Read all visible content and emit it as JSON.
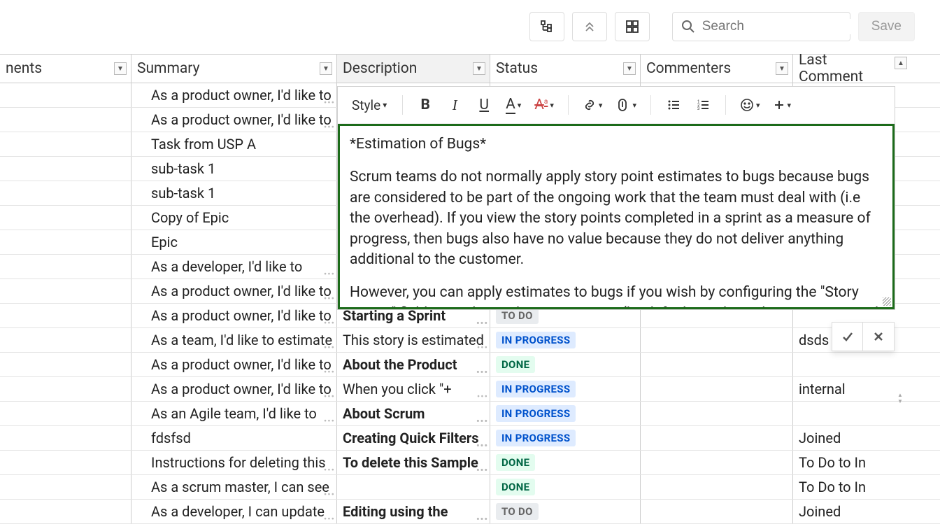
{
  "toolbar": {
    "search_placeholder": "Search",
    "save_label": "Save"
  },
  "columns": {
    "nents": "nents",
    "summary": "Summary",
    "description": "Description",
    "status": "Status",
    "commenters": "Commenters",
    "last_comment": "Last Comment"
  },
  "rows": [
    {
      "summary": "As a product owner, I'd like to",
      "summary_dots": true
    },
    {
      "summary": "As a product owner, I'd like to",
      "summary_dots": true
    },
    {
      "summary": "Task from USP A"
    },
    {
      "summary": "sub-task 1"
    },
    {
      "summary": "sub-task 1"
    },
    {
      "summary": "Copy of Epic"
    },
    {
      "summary": "Epic"
    },
    {
      "summary": "As a developer, I'd like to",
      "summary_dots": true
    },
    {
      "summary": "As a product owner, I'd like to",
      "summary_dots": true
    },
    {
      "summary": "As a product owner, I'd like to",
      "summary_dots": true,
      "description": "Starting a Sprint",
      "desc_bold": true,
      "desc_dots": true,
      "status": "TO DO",
      "status_class": "st-todo"
    },
    {
      "summary": "As a team, I'd like to estimate",
      "summary_dots": true,
      "description": "This story is estimated",
      "desc_dots": true,
      "status": "IN PROGRESS",
      "status_class": "st-inprogress",
      "last": "dsds"
    },
    {
      "summary": "As a product owner, I'd like to",
      "summary_dots": true,
      "description": "About the Product",
      "desc_bold": true,
      "desc_dots": true,
      "status": "DONE",
      "status_class": "st-done"
    },
    {
      "summary": "As a product owner, I'd like to",
      "summary_dots": true,
      "description": "When you click \"+",
      "desc_dots": true,
      "status": "IN PROGRESS",
      "status_class": "st-inprogress",
      "last": "internal"
    },
    {
      "summary": "As an Agile team, I'd like to",
      "summary_dots": true,
      "description": "About Scrum",
      "desc_bold": true,
      "desc_dots": true,
      "status": "IN PROGRESS",
      "status_class": "st-inprogress"
    },
    {
      "summary": "fdsfsd",
      "description": "Creating Quick Filters",
      "desc_bold": true,
      "desc_dots": true,
      "status": "IN PROGRESS",
      "status_class": "st-inprogress",
      "last": "Joined"
    },
    {
      "summary": "Instructions for deleting this",
      "summary_dots": true,
      "description": "To delete this Sample",
      "desc_bold": true,
      "desc_dots": true,
      "status": "DONE",
      "status_class": "st-done",
      "last": "To Do to In"
    },
    {
      "summary": "As a scrum master, I can see",
      "summary_dots": true,
      "status": "DONE",
      "status_class": "st-done",
      "last": "To Do to In"
    },
    {
      "summary": "As a developer, I can update",
      "summary_dots": true,
      "description": "Editing using the",
      "desc_bold": true,
      "desc_dots": true,
      "status": "TO DO",
      "status_class": "st-todo",
      "last": "Joined"
    }
  ],
  "editor": {
    "style_label": "Style",
    "content_p1": "*Estimation of Bugs*",
    "content_p2": "Scrum teams do not normally apply story point estimates to bugs because bugs are considered to be part of the ongoing work that the team must deal with (i.e the overhead). If you view the story points completed in a sprint as a measure of progress, then bugs also have no value because they do not deliver anything additional to the customer.",
    "content_p3": "However, you can apply estimates to bugs if you wish by configuring the \"Story Points\" field to apply to other Issue Types (by default it only applies to Stories and Epics). Some more information on this is in the [documentation|https://confluence.atlassian.com/display/GH/Story+Point].|"
  }
}
